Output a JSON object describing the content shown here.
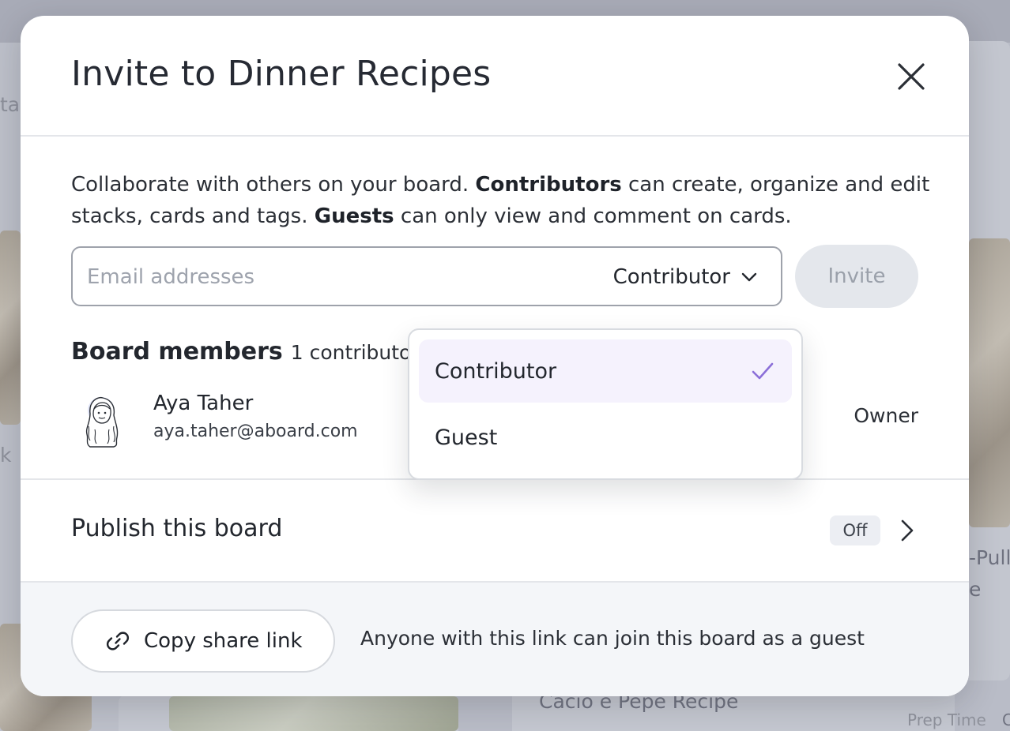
{
  "background": {
    "left_text_top": "ta",
    "left_text_mid": "k",
    "right_text_1": "-Pull",
    "right_text_2": "e",
    "bottom_card_title": "Cacio e Pepe Recipe",
    "bottom_right_label": "Prep Time",
    "bottom_right_value": "C"
  },
  "modal": {
    "title": "Invite to Dinner Recipes",
    "close_icon": "close-icon"
  },
  "description": {
    "part1": "Collaborate with others on your board. ",
    "contributors_bold": "Contributors",
    "part2": " can create, organize and edit stacks, cards and tags. ",
    "guests_bold": "Guests",
    "part3": " can only view and comment on cards."
  },
  "invite": {
    "email_placeholder": "Email addresses",
    "email_value": "",
    "role_selected": "Contributor",
    "role_icon": "chevron-down-icon",
    "invite_button": "Invite",
    "invite_enabled": false
  },
  "members": {
    "title": "Board members",
    "count_text": "1 contributor",
    "list": [
      {
        "name": "Aya Taher",
        "email": "aya.taher@aboard.com",
        "role": "Owner"
      }
    ]
  },
  "publish": {
    "label": "Publish this board",
    "status": "Off",
    "chevron": "chevron-right-icon"
  },
  "share": {
    "button_label": "Copy share link",
    "icon": "link-icon",
    "hint": "Anyone with this link can join this board as a guest"
  },
  "role_dropdown": {
    "open": true,
    "options": [
      {
        "label": "Contributor",
        "selected": true
      },
      {
        "label": "Guest",
        "selected": false
      }
    ],
    "check_icon": "check-icon"
  },
  "colors": {
    "overlay_bg": "#b9bcc7",
    "modal_bg": "#ffffff",
    "footer_bg": "#f4f6f9",
    "check_accent": "#8b6fd8",
    "selected_option_bg": "#f5f2fd",
    "invite_disabled_bg": "#e4e7ec"
  }
}
